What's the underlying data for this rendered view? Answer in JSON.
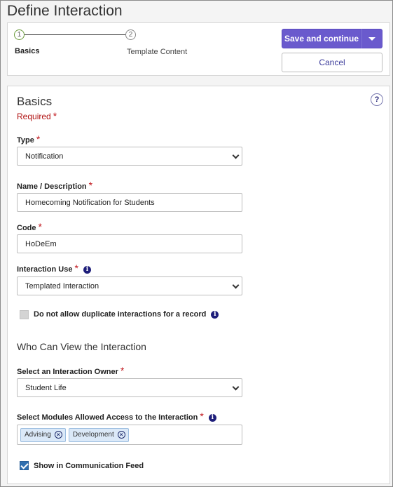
{
  "page": {
    "title": "Define Interaction"
  },
  "steps": [
    {
      "number": "1",
      "label": "Basics"
    },
    {
      "number": "2",
      "label": "Template Content"
    }
  ],
  "actions": {
    "save_label": "Save and continue",
    "cancel_label": "Cancel"
  },
  "basics": {
    "title": "Basics",
    "help": "?",
    "required_note": "Required",
    "type": {
      "label": "Type",
      "value": "Notification"
    },
    "name": {
      "label": "Name / Description",
      "value": "Homecoming Notification for Students"
    },
    "code": {
      "label": "Code",
      "value": "HoDeEm"
    },
    "interaction_use": {
      "label": "Interaction Use",
      "value": "Templated Interaction"
    },
    "no_duplicates": {
      "label": "Do not allow duplicate interactions for a record",
      "checked": false
    }
  },
  "visibility": {
    "title": "Who Can View the Interaction",
    "owner": {
      "label": "Select an Interaction Owner",
      "value": "Student Life"
    },
    "modules": {
      "label": "Select Modules Allowed Access to the Interaction",
      "chips": [
        "Advising",
        "Development"
      ]
    },
    "show_feed": {
      "label": "Show in Communication Feed",
      "checked": true
    }
  },
  "colors": {
    "primary": "#6a5acd",
    "required": "#c0161c",
    "chip_bg": "#dbe9f8",
    "checkbox_checked": "#2f6fb0"
  },
  "icons": {
    "help": "question-circle-icon",
    "info": "info-circle-icon",
    "chip_remove": "close-circle-icon",
    "dropdown": "chevron-down-icon"
  }
}
